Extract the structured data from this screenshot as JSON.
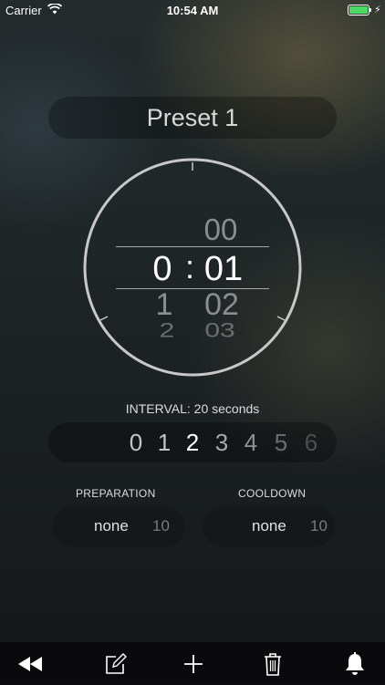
{
  "status_bar": {
    "carrier": "Carrier",
    "time": "10:54 AM"
  },
  "preset": {
    "title": "Preset 1"
  },
  "timer": {
    "minutes_column": [
      "",
      "0",
      "1",
      "2"
    ],
    "seconds_column": [
      "00",
      "01",
      "02",
      "03"
    ],
    "selected": {
      "minutes": "0",
      "separator": ":",
      "seconds": "01"
    }
  },
  "interval": {
    "label": "INTERVAL: 20 seconds",
    "options": [
      "0",
      "1",
      "2",
      "3",
      "4",
      "5",
      "6"
    ],
    "selected": "2"
  },
  "preparation": {
    "label": "PREPARATION",
    "value": "none",
    "next": "10"
  },
  "cooldown": {
    "label": "COOLDOWN",
    "value": "none",
    "next": "10"
  },
  "toolbar": {
    "items": [
      "rewind-icon",
      "edit-icon",
      "add-icon",
      "trash-icon",
      "bell-icon"
    ]
  },
  "colors": {
    "accent": "#ffffff",
    "battery": "#4cd964",
    "dial": "#c8c8c8"
  }
}
